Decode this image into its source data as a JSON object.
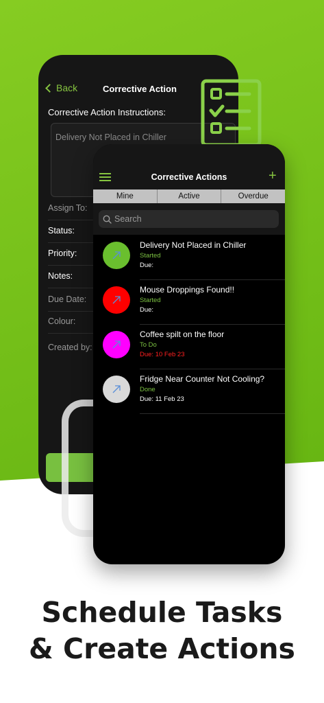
{
  "detail_screen": {
    "back_label": "Back",
    "title": "Corrective Action",
    "instructions_label": "Corrective Action Instructions:",
    "instructions_value": "Delivery Not Placed in Chiller",
    "fields": [
      {
        "label": "Assign To:",
        "color": "#9a9a9a"
      },
      {
        "label": "Status:",
        "color": "#ffffff"
      },
      {
        "label": "Priority:",
        "color": "#ffffff"
      },
      {
        "label": "Notes:",
        "color": "#ffffff"
      },
      {
        "label": "Due Date:",
        "color": "#9a9a9a"
      },
      {
        "label": "Colour:",
        "color": "#9a9a9a"
      },
      {
        "label": "Created by:",
        "color": "#9a9a9a"
      }
    ]
  },
  "list_screen": {
    "title": "Corrective Actions",
    "menu_icon": "hamburger-icon",
    "add_icon": "plus-icon",
    "tabs": [
      "Mine",
      "Active",
      "Overdue"
    ],
    "search_placeholder": "Search",
    "items": [
      {
        "title": "Delivery Not Placed in Chiller",
        "status": "Started",
        "status_color": "#7cc242",
        "due": "Due:",
        "due_color": "#ffffff",
        "avatar_color": "#6abf2e"
      },
      {
        "title": "Mouse Droppings Found!!",
        "status": "Started",
        "status_color": "#7cc242",
        "due": "Due:",
        "due_color": "#ffffff",
        "avatar_color": "#ff0000"
      },
      {
        "title": "Coffee spilt on the floor",
        "status": "To Do",
        "status_color": "#7cc242",
        "due": "Due: 10 Feb 23",
        "due_color": "#ff2020",
        "avatar_color": "#ff00ff"
      },
      {
        "title": "Fridge Near Counter Not Cooling?",
        "status": "Done",
        "status_color": "#7cc242",
        "due": "Due: 11 Feb 23",
        "due_color": "#ffffff",
        "avatar_color": "#d9d9d9"
      }
    ]
  },
  "headline": {
    "line1": "Schedule Tasks",
    "line2": "& Create Actions"
  },
  "colors": {
    "brand_green": "#86c440",
    "background_green": "#75bf1a"
  }
}
